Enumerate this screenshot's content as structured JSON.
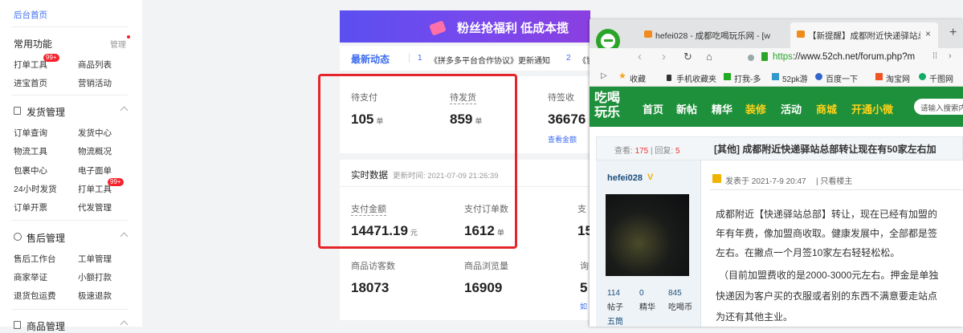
{
  "sidebar": {
    "home_link": "后台首页",
    "common_title": "常用功能",
    "manage_label": "管理",
    "common_items": [
      "打单工具",
      "商品列表",
      "进宝首页",
      "营销活动"
    ],
    "common_badge": "99+",
    "shipping_title": "发货管理",
    "shipping_items": [
      "订单查询",
      "发货中心",
      "物流工具",
      "物流概况",
      "包裹中心",
      "电子面单",
      "24小时发货",
      "打单工具",
      "订单开票",
      "代发管理"
    ],
    "shipping_badge": "99+",
    "aftersale_title": "售后管理",
    "aftersale_items": [
      "售后工作台",
      "工单管理",
      "商家举证",
      "小额打款",
      "退货包运费",
      "极速退款"
    ],
    "goods_title": "商品管理"
  },
  "banner": {
    "text": "粉丝抢福利 低成本揽"
  },
  "news": {
    "label": "最新动态",
    "item1_no": "1",
    "item1_text": "《拼多多平台合作协议》更新通知",
    "item2_no": "2",
    "item2_text": "《协"
  },
  "orders": {
    "pay_label": "待支付",
    "pay_value": "105",
    "pay_unit": "单",
    "ship_label": "待发货",
    "ship_value": "859",
    "ship_unit": "单",
    "sign_label": "待签收",
    "sign_value": "36676",
    "view_amount": "查看金额"
  },
  "realtime": {
    "title": "实时数据",
    "update_time": "更新时间: 2021-07-09 21:26:39",
    "amount_label": "支付金额",
    "amount_value": "14471.19",
    "amount_unit": "元",
    "count_label": "支付订单数",
    "count_value": "1612",
    "count_unit": "单",
    "col3_label": "支",
    "col3_value": "15",
    "visitors_label": "商品访客数",
    "visitors_value": "18073",
    "views_label": "商品浏览量",
    "views_value": "16909",
    "col3b_label": "询",
    "col3b_value": "5",
    "col3b_sub": "如"
  },
  "browser": {
    "tab1": "hefei028 - 成都吃喝玩乐网 - [w",
    "tab2": "【新提醒】成都附近快递驿站总",
    "url_prefix": "https",
    "url_rest": "://www.52ch.net/forum.php?m",
    "bookmarks": [
      "收藏",
      "手机收藏夹",
      "打我-多",
      "52pk游",
      "百度一下",
      "淘宝网",
      "千图网"
    ],
    "logo_top": "吃喝",
    "logo_bottom": "玩乐",
    "nav": [
      "首页",
      "新帖",
      "精华",
      "装修",
      "活动",
      "商城",
      "开通小微"
    ],
    "search_placeholder": "请输入搜索内",
    "views_label": "查看:",
    "views": "175",
    "replies_label": "回复:",
    "replies": "5",
    "thread_title": "[其他] 成都附近快递驿站总部转让现在有50家左右加",
    "author": "hefei028",
    "posted": "发表于 2021-7-9 20:47",
    "only_author": "只看楼主",
    "stats": [
      {
        "v": "114",
        "l": "帖子"
      },
      {
        "v": "0",
        "l": "精华"
      },
      {
        "v": "845",
        "l": "吃喝币"
      }
    ],
    "rank": "五筒",
    "lines": [
      "成都附近【快递驿站总部】转让，现在已经有加盟的",
      "年有年费，像加盟商收取。健康发展中，全部都是签",
      "左右。在撇点一个月签10家左右轻轻松松。",
      "（目前加盟费收的是2000-3000元左右。押金是单独",
      "快递因为客户买的衣服或者别的东西不满意要走站点",
      "为还有其他主业。"
    ]
  },
  "colors": {
    "accent": "#3c6cf0",
    "red": "#e4262c",
    "site_green": "#1e8f3a"
  }
}
